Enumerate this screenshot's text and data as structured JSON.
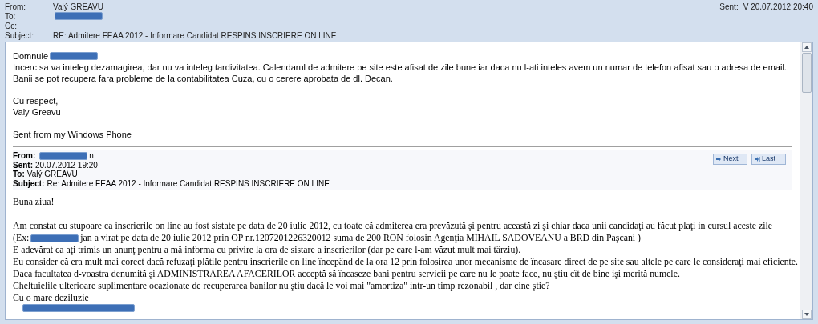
{
  "header": {
    "fields": [
      {
        "label": "From:",
        "segments": [
          {
            "kind": "text",
            "text": "Valý GREAVU"
          }
        ]
      },
      {
        "label": "To:",
        "segments": [
          {
            "kind": "redacted"
          }
        ]
      },
      {
        "label": "Cc:"
      },
      {
        "label": "Subject:",
        "segments": [
          {
            "kind": "text",
            "text": "RE: Admitere FEAA 2012 - Informare Candidat RESPINS INSCRIERE ON LINE"
          }
        ]
      }
    ],
    "sent": {
      "label": "Sent:",
      "value": "V 20.07.2012 20:40"
    }
  },
  "reply": {
    "paragraphs": [
      [
        [
          {
            "kind": "text",
            "text": "Domnule"
          },
          {
            "kind": "redacted"
          }
        ],
        [
          {
            "kind": "text",
            "text": "Incerc sa va inteleg dezamagirea, dar nu va inteleg tardivitatea. Calendarul de admitere pe site este afisat de zile bune iar daca nu l-ati inteles avem un numar de telefon afisat sau o adresa de email."
          }
        ],
        [
          {
            "kind": "text",
            "text": "Banii se pot recupera fara probleme de la contabilitatea Cuza, cu o cerere aprobata de dl. Decan."
          }
        ]
      ],
      [
        [
          {
            "kind": "text",
            "text": "Cu respect,"
          }
        ],
        [
          {
            "kind": "text",
            "text": "Valy Greavu"
          }
        ]
      ],
      [
        [
          {
            "kind": "text",
            "text": "Sent from my Windows Phone"
          }
        ]
      ]
    ]
  },
  "quoted": {
    "fields": [
      {
        "label": "From:",
        "segments": [
          {
            "kind": "redacted"
          },
          {
            "kind": "text",
            "text": "n"
          }
        ]
      },
      {
        "label": "Sent:",
        "segments": [
          {
            "kind": "text",
            "text": "20.07.2012 19:20"
          }
        ]
      },
      {
        "label": "To:",
        "segments": [
          {
            "kind": "text",
            "text": "Valý GREAVU"
          }
        ]
      },
      {
        "label": "Subject:",
        "segments": [
          {
            "kind": "text",
            "text": "Re: Admitere FEAA 2012 - Informare Candidat RESPINS INSCRIERE ON LINE"
          }
        ]
      }
    ],
    "nav_buttons": [
      {
        "kind": "next",
        "label": "Next"
      },
      {
        "kind": "last",
        "label": "Last"
      }
    ],
    "paragraphs": [
      [
        [
          {
            "kind": "text",
            "text": "Buna ziua!"
          }
        ]
      ],
      [
        [
          {
            "kind": "text",
            "text": "Am constat cu stupoare ca inscrierile on line au fost sistate pe data de 20 iulie 2012, cu toate că admiterea era prevăzută şi pentru această zi şi chiar daca unii candidaţi au făcut plaţi in cursul aceste zile"
          }
        ],
        [
          {
            "kind": "text",
            "text": "(Ex:"
          },
          {
            "kind": "redacted"
          },
          {
            "kind": "text",
            "text": "jan a virat pe data de 20 iulie 2012 prin OP nr.1207201226320012 suma de 200 RON folosin Agenţia MIHAIL SADOVEANU a BRD din Paşcani )"
          }
        ],
        [
          {
            "kind": "text",
            "text": "E adevărat ca aţi trimis un anunţ pentru a mă informa cu privire la ora de sistare a inscrierilor (dar pe care l-am văzut mult mai târziu)."
          }
        ],
        [
          {
            "kind": "text",
            "text": "Eu consider că era mult mai corect dacă refuzaţi plătile pentru inscrierile on line începând de la ora 12 prin folosirea unor mecanisme de încasare direct de pe site sau altele pe care le consideraţi mai eficiente."
          }
        ],
        [
          {
            "kind": "text",
            "text": "Daca facultatea d-voastra denumită şi ADMINISTRAREA AFACERILOR acceptă să încaseze bani pentru servicii pe care nu le poate face, nu ştiu cît de bine işi merită numele."
          }
        ],
        [
          {
            "kind": "text",
            "text": "Cheltuielile ulterioare suplimentare ocazionate de recuperarea banilor nu ştiu dacă le voi mai \"amortiza\" intr-un timp rezonabil , dar cine ştie?"
          }
        ],
        [
          {
            "kind": "text",
            "text": "Cu o mare deziluzie"
          }
        ],
        [
          {
            "kind": "signature_redacted"
          }
        ]
      ]
    ]
  }
}
